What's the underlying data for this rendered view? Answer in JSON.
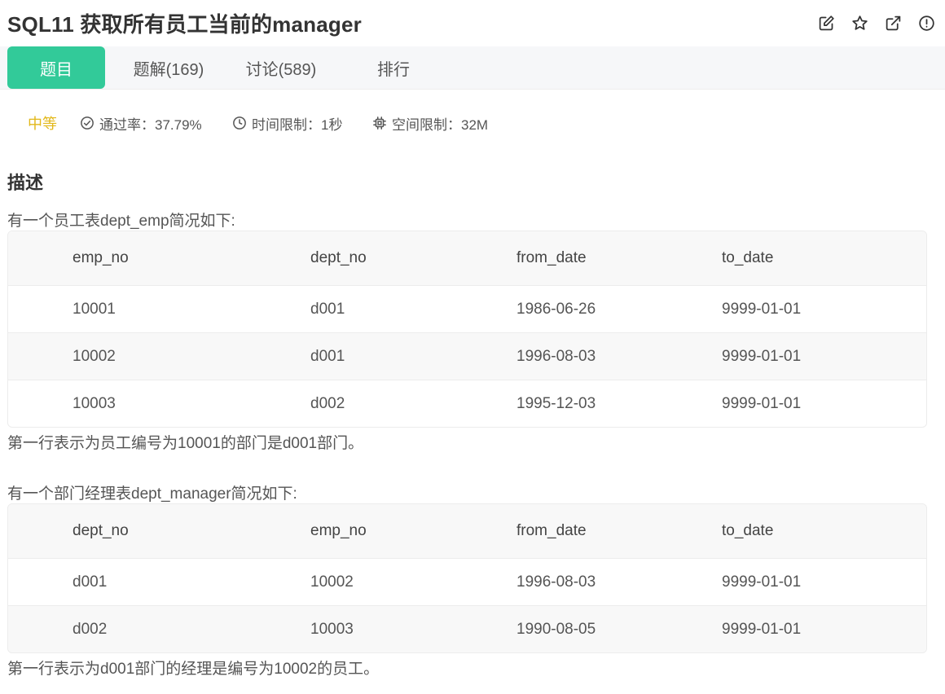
{
  "header": {
    "title": "SQL11  获取所有员工当前的manager",
    "icons": [
      "edit-icon",
      "star-icon",
      "share-icon",
      "info-icon"
    ]
  },
  "tabs": [
    {
      "label": "题目",
      "active": true
    },
    {
      "label": "题解(169)",
      "active": false
    },
    {
      "label": "讨论(589)",
      "active": false
    },
    {
      "label": "排行",
      "active": false
    }
  ],
  "meta": {
    "difficulty": "中等",
    "pass_rate": "通过率：37.79%",
    "time_limit": "时间限制：1秒",
    "space_limit": "空间限制：32M"
  },
  "description": {
    "title": "描述",
    "intro1": "有一个员工表dept_emp简况如下:",
    "note1": "第一行表示为员工编号为10001的部门是d001部门。",
    "intro2": "有一个部门经理表dept_manager简况如下:",
    "note2": "第一行表示为d001部门的经理是编号为10002的员工。"
  },
  "dept_emp": {
    "headers": [
      "emp_no",
      "dept_no",
      "from_date",
      "to_date"
    ],
    "rows": [
      [
        "10001",
        "d001",
        "1986-06-26",
        "9999-01-01"
      ],
      [
        "10002",
        "d001",
        "1996-08-03",
        "9999-01-01"
      ],
      [
        "10003",
        "d002",
        "1995-12-03",
        "9999-01-01"
      ]
    ]
  },
  "dept_manager": {
    "headers": [
      "dept_no",
      "emp_no",
      "from_date",
      "to_date"
    ],
    "rows": [
      [
        "d001",
        "10002",
        "1996-08-03",
        "9999-01-01"
      ],
      [
        "d002",
        "10003",
        "1990-08-05",
        "9999-01-01"
      ]
    ]
  },
  "colors": {
    "accent": "#32ca99",
    "difficulty": "#e2b81a",
    "text": "#333333"
  }
}
